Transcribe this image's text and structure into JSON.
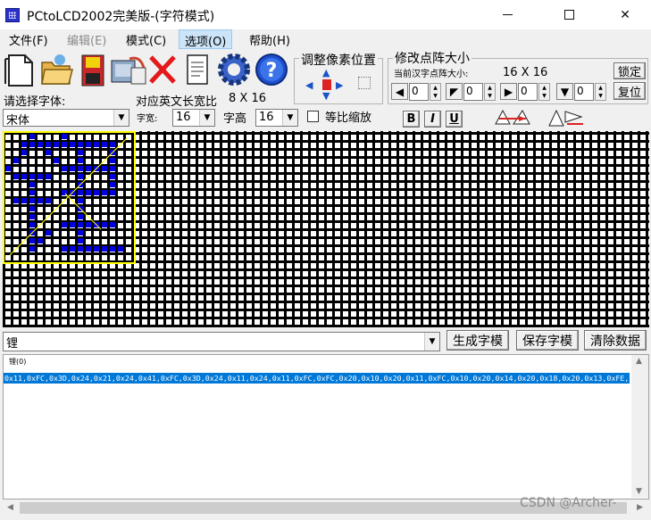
{
  "window": {
    "title": "PCtoLCD2002完美版-(字符模式)",
    "minimize_icon": "minimize-icon",
    "maximize_icon": "maximize-icon",
    "close_glyph": "✕"
  },
  "menu": {
    "items": [
      {
        "label": "文件(F)",
        "state": "normal"
      },
      {
        "label": "编辑(E)",
        "state": "disabled"
      },
      {
        "label": "模式(C)",
        "state": "normal"
      },
      {
        "label": "选项(O)",
        "state": "active"
      },
      {
        "label": "帮助(H)",
        "state": "normal"
      }
    ]
  },
  "toolbar": {
    "icons": [
      "new-file-icon",
      "open-folder-icon",
      "save-disk-icon",
      "export-icon",
      "delete-icon",
      "notes-icon",
      "settings-gear-icon",
      "help-icon"
    ]
  },
  "font_panel": {
    "select_font_label": "请选择字体:",
    "font_value": "宋体",
    "ratio_label": "对应英文长宽比",
    "ratio_value": "8 X 16",
    "width_label": "字宽:",
    "width_value": "16",
    "height_label": "字高",
    "height_value": "16",
    "proportional_label": "等比缩放",
    "proportional_checked": false,
    "bold_label": "B",
    "italic_label": "I",
    "underline_label": "U"
  },
  "adjust_panel": {
    "title": "调整像素位置"
  },
  "resize_panel": {
    "title": "修改点阵大小",
    "current_label": "当前汉字点阵大小:",
    "current_value": "16 X 16",
    "lock_label": "锁定",
    "reset_label": "复位",
    "spinners": [
      "0",
      "0",
      "0",
      "0"
    ]
  },
  "matrix": {
    "on_color": "#0000e0",
    "grid_color": "#000000",
    "selection_color": "#ffff00",
    "guide_color": "#ffff00",
    "bitmap": [
      "0001000100000000",
      "0011111111111100",
      "0010010001000100",
      "0100001001000100",
      "1000000111111100",
      "0111110001000100",
      "0001000001000100",
      "0001000111111100",
      "0111110001000000",
      "0001000001000000",
      "0001000001000000",
      "0001000111111100",
      "0001010001000000",
      "0001100001000000",
      "0001000111111110",
      "0000000000000000"
    ]
  },
  "bottom": {
    "char_value": "锂",
    "generate_label": "生成字模",
    "save_label": "保存字模",
    "clear_label": "清除数据",
    "output_header": "锂(0)",
    "output_hex": "0x11,0xFC,0x3D,0x24,0x21,0x24,0x41,0xFC,0x3D,0x24,0x11,0x24,0x11,0xFC,0xFC,0x20,0x10,0x20,0x11,0xFC,0x10,0x20,0x14,0x20,0x18,0x20,0x13,0xFE,"
  },
  "watermark": "CSDN @Archer-"
}
